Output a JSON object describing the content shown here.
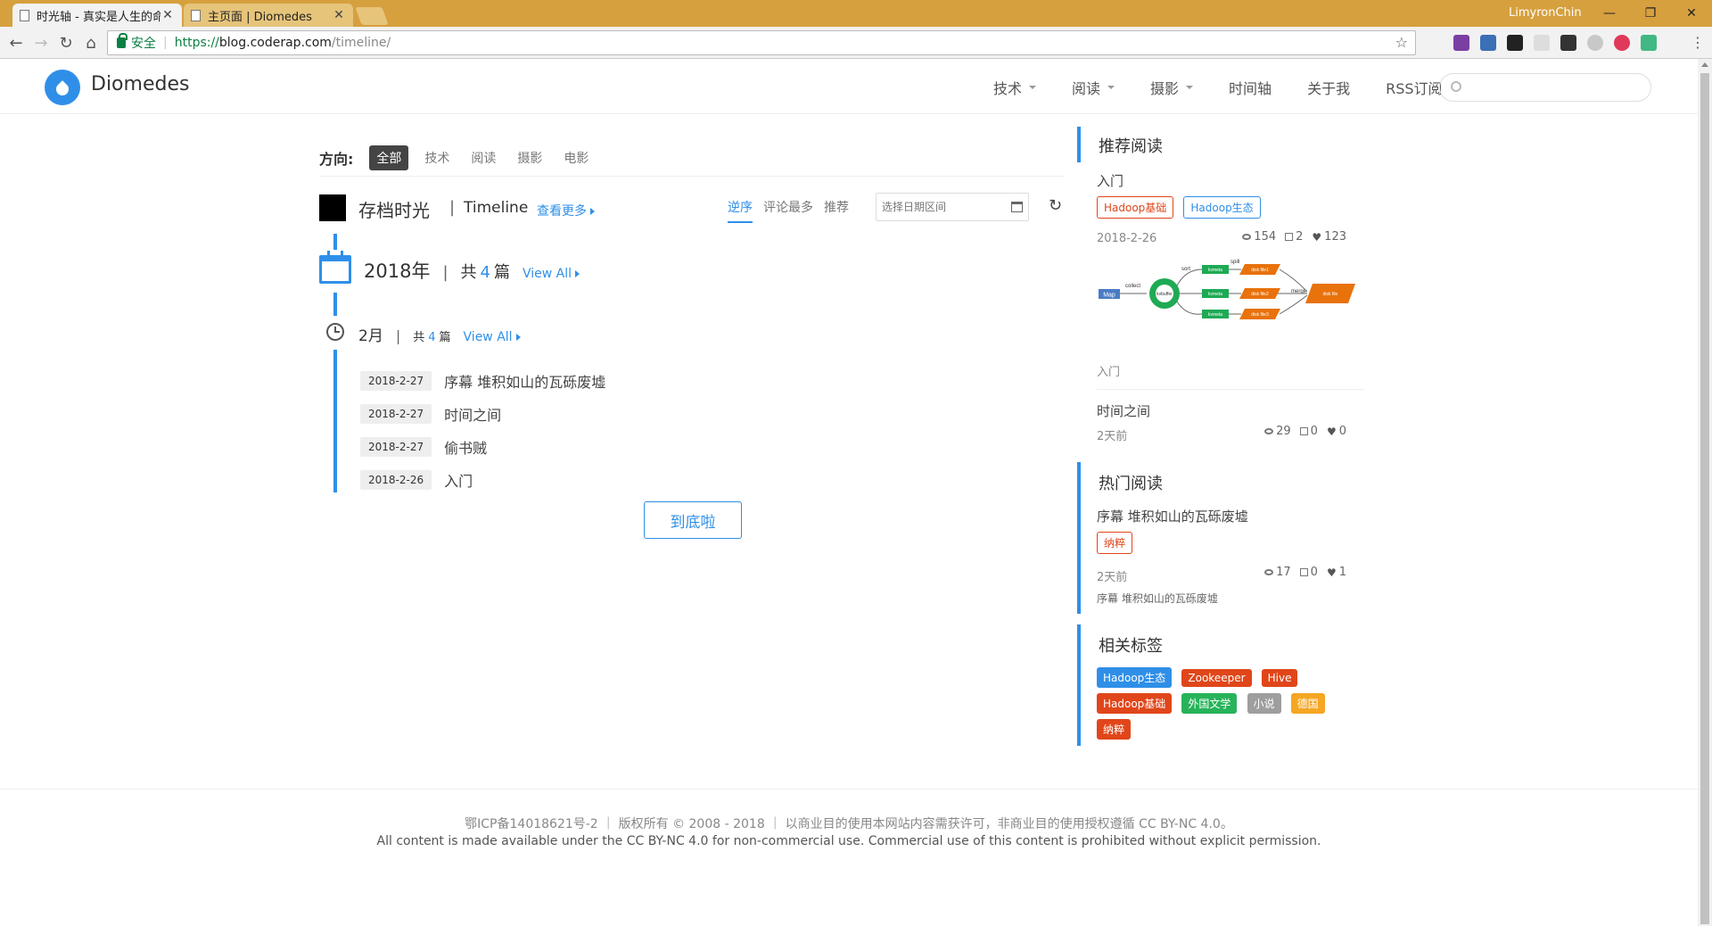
{
  "browser": {
    "tabs": [
      {
        "title": "时光轴 - 真实是人生的命"
      },
      {
        "title": "主页面 | Diomedes"
      }
    ],
    "user": "LimyronChin",
    "address": {
      "secure_label": "安全",
      "url_scheme": "https://",
      "url_host": "blog.coderap.com",
      "url_path": "/timeline/"
    }
  },
  "header": {
    "site_name": "Diomedes",
    "nav": [
      {
        "label": "技术",
        "has_dropdown": true
      },
      {
        "label": "阅读",
        "has_dropdown": true
      },
      {
        "label": "摄影",
        "has_dropdown": true
      },
      {
        "label": "时间轴",
        "has_dropdown": false
      },
      {
        "label": "关于我",
        "has_dropdown": false
      },
      {
        "label": "RSS订阅",
        "has_dropdown": false
      }
    ]
  },
  "filter": {
    "label": "方向:",
    "options": [
      "全部",
      "技术",
      "阅读",
      "摄影",
      "电影"
    ],
    "active": "全部"
  },
  "timeline": {
    "title": "存档时光",
    "divider": "|",
    "title_en": "Timeline",
    "more": "查看更多",
    "sort": [
      "逆序",
      "评论最多",
      "推荐"
    ],
    "active_sort": "逆序",
    "date_placeholder": "选择日期区间",
    "year": {
      "label": "2018年",
      "total_prefix": "共",
      "total": "4",
      "total_suffix": "篇",
      "view_all": "View All"
    },
    "month": {
      "label": "2月",
      "total_prefix": "共",
      "total": "4",
      "total_suffix": "篇",
      "view_all": "View All"
    },
    "posts": [
      {
        "date": "2018-2-27",
        "title": "序幕 堆积如山的瓦砾废墟"
      },
      {
        "date": "2018-2-27",
        "title": "时间之间"
      },
      {
        "date": "2018-2-27",
        "title": "偷书贼"
      },
      {
        "date": "2018-2-26",
        "title": "入门"
      }
    ],
    "bottom_button": "到底啦"
  },
  "sidebar": {
    "recommended": {
      "title": "推荐阅读",
      "featured": {
        "title": "入门",
        "tags": [
          {
            "label": "Hadoop基础",
            "color": "#e0461a"
          },
          {
            "label": "Hadoop生态",
            "color": "#2f8fe8"
          }
        ],
        "date": "2018-2-26",
        "views": "154",
        "comments": "2",
        "likes": "123",
        "diagram": {
          "map_label": "Map",
          "collect_label": "collect",
          "buffer_label": "kvbuffer",
          "sort_label": "sort",
          "spill_label": "spill",
          "merge_label": "merge",
          "kvmeta_label": "kvmeta",
          "disk_files": [
            "disk file1",
            "disk file2",
            "disk file3"
          ],
          "output_label": "disk file"
        },
        "caption": "入门"
      },
      "second": {
        "title": "时间之间",
        "ago": "2天前",
        "views": "29",
        "comments": "0",
        "likes": "0"
      }
    },
    "hot": {
      "title": "热门阅读",
      "post": {
        "title": "序幕 堆积如山的瓦砾废墟",
        "tag": "纳粹",
        "ago": "2天前",
        "views": "17",
        "comments": "0",
        "likes": "1",
        "excerpt": "序幕 堆积如山的瓦砾废墟"
      }
    },
    "tags": {
      "title": "相关标签",
      "items": [
        {
          "label": "Hadoop生态",
          "color": "#2f8fe8"
        },
        {
          "label": "Zookeeper",
          "color": "#e0461a"
        },
        {
          "label": "Hive",
          "color": "#e0461a"
        },
        {
          "label": "Hadoop基础",
          "color": "#e0461a"
        },
        {
          "label": "外国文学",
          "color": "#27b35a"
        },
        {
          "label": "小说",
          "color": "#9e9e9e"
        },
        {
          "label": "德国",
          "color": "#f5a623"
        },
        {
          "label": "纳粹",
          "color": "#e0461a"
        }
      ]
    }
  },
  "footer": {
    "line1": "鄂ICP备14018621号-2 ｜ 版权所有 © 2008 - 2018 ｜ 以商业目的使用本网站内容需获许可，非商业目的使用授权遵循 CC BY-NC 4.0。",
    "line2": "All content is made available under the CC BY-NC 4.0 for non-commercial use. Commercial use of this content is prohibited without explicit permission."
  }
}
